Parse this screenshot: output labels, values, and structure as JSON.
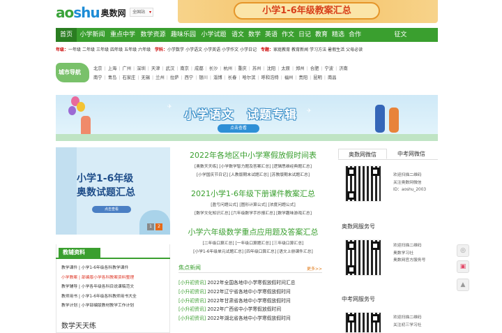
{
  "header": {
    "logo_text": "aoshu",
    "logo_cn": "奥数网",
    "city_select": "全国站",
    "banner_text": "小学1-6年级教案汇总"
  },
  "nav": [
    "首页",
    "小学新闻",
    "重点中学",
    "数学资源",
    "趣味乐园",
    "小学试题",
    "语文",
    "数学",
    "英语",
    "作文",
    "日记",
    "教育",
    "精选",
    "合作",
    "征文"
  ],
  "subnav": {
    "grade_label": "年级：",
    "grades": [
      "一年级",
      "二年级",
      "三年级",
      "四年级",
      "五年级",
      "六年级"
    ],
    "subject_label": "学科：",
    "subjects": [
      "小学数学",
      "小学语文",
      "小学英语",
      "小学作文",
      "小学日记"
    ],
    "topic_label": "专题：",
    "topics": [
      "家庭教育",
      "教育新闻",
      "学习方法",
      "暑假生活",
      "父母必读"
    ]
  },
  "city_nav": {
    "label": "城市导航",
    "row1": [
      "北京",
      "上海",
      "广州",
      "深圳",
      "天津",
      "武汉",
      "南京",
      "成都",
      "长沙",
      "杭州",
      "重庆",
      "苏州",
      "沈阳",
      "太原",
      "郑州",
      "合肥",
      "宁波",
      "济南"
    ],
    "row2": [
      "南宁",
      "青岛",
      "石家庄",
      "无锡",
      "兰州",
      "拉萨",
      "西宁",
      "银川",
      "淄博",
      "长春",
      "哈尔滨",
      "呼和浩特",
      "福州",
      "贵阳",
      "昆明",
      "南昌"
    ]
  },
  "big_banner": {
    "title": "小学语文　试题专辑",
    "button": "点击查看"
  },
  "promo": {
    "line1": "小学1-6年级",
    "line2": "奥数试题汇总",
    "button": "点击查看",
    "pages": [
      "1",
      "2"
    ]
  },
  "jiaofu": {
    "tag": "教辅资料",
    "items": [
      "教学课件 | 小学1-6年级各科教学课件",
      "小学教案 | 部编版小学各科教案资料整理",
      "教学辅导 | 小学各年级各科目说课稿范文",
      "教师用书 | 小学1-6年级各科教师用书大全",
      "教学计划 | 小学部编版教材教学工作计划"
    ],
    "practice_title": "数学天天练"
  },
  "center": {
    "blocks": [
      {
        "title": "2022年各地区中小学寒假放假时间表",
        "rows": [
          "[奥数天天练] [小学数学智力题及答案汇总] [逻辑思维经典题汇总]",
          "[小学国庆节日记] [人教版期末试题汇总] [苏教版期末试题汇总]"
        ]
      },
      {
        "title": "2021小学1-6年级下册课件教案汇总",
        "rows": [
          "[盈亏问题公式] [图形计算公式] [浓度问题公式]",
          "[数学文化知识汇总] [六年级数学手抄报汇总] [数学趣味游戏汇总]"
        ]
      },
      {
        "title": "小学六年级数学重点应用题及答案汇总",
        "rows": [
          "[二年级口算汇总] [一年级口算题汇总] [三年级口算汇总]",
          "[小学1-6年级单元试题汇总] [四年级口算汇总] [语文上册课件汇总]"
        ]
      }
    ]
  },
  "focus_news": {
    "title": "焦点新闻",
    "more": "更多>>",
    "category": "[小升初资讯]",
    "items": [
      "2022年全国各地中小学寒假放假时间汇总",
      "2022年辽宁省各地中小学寒假放假时间",
      "2022年甘肃省各地中小学寒假放假时间",
      "2022年广西省中小学寒假放假时间",
      "2022年湖北省各地中小学寒假放假时间"
    ]
  },
  "right": {
    "tabs": [
      "奥数网微信",
      "中考网微信"
    ],
    "wechat_desc": [
      "欢迎扫描二维码",
      "关注奥数网微信",
      "ID：aoshu_2003"
    ],
    "service_title": "奥数网服务号",
    "service_desc": [
      "欢迎扫描二维码",
      "奥数学习社",
      "奥数网官方服务号"
    ],
    "zhongkao_title": "中考网服务号",
    "zhongkao_desc": [
      "欢迎扫描二维码",
      "关注初三学习社"
    ]
  },
  "colors": {
    "brand_green": "#3a9f2f",
    "accent_orange": "#e07b1a",
    "highlight_red": "#d32222"
  }
}
